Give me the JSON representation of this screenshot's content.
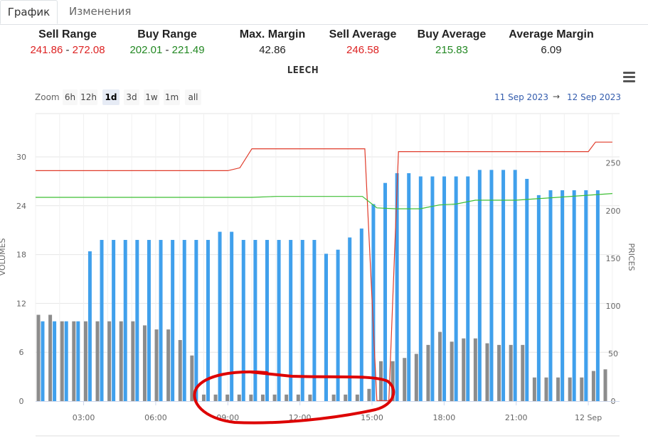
{
  "tabs": [
    "График",
    "Изменения"
  ],
  "stats": {
    "sell_range": {
      "label": "Sell Range",
      "low": "241.86",
      "sep": "-",
      "high": "272.08"
    },
    "buy_range": {
      "label": "Buy Range",
      "low": "202.01",
      "sep": "-",
      "high": "221.49"
    },
    "max_margin": {
      "label": "Max. Margin",
      "value": "42.86"
    },
    "sell_average": {
      "label": "Sell Average",
      "value": "246.58"
    },
    "buy_average": {
      "label": "Buy Average",
      "value": "215.83"
    },
    "average_margin": {
      "label": "Average Margin",
      "value": "6.09"
    }
  },
  "zoom": {
    "label": "Zoom",
    "buttons": [
      "6h",
      "12h",
      "1d",
      "3d",
      "1w",
      "1m",
      "all"
    ],
    "selected": "1d"
  },
  "date_range": {
    "from": "11 Sep 2023",
    "arrow": "→",
    "to": "12 Sep 2023"
  },
  "chart_data": {
    "type": "bar+line",
    "title": "LEECH",
    "x_ticks": [
      "03:00",
      "06:00",
      "09:00",
      "12:00",
      "15:00",
      "18:00",
      "21:00",
      "12 Sep"
    ],
    "x_start_hour": 1.0,
    "x_end_hour": 25.3,
    "y_left": {
      "label": "VOLUMES",
      "ticks": [
        "0",
        "6",
        "12",
        "18",
        "24",
        "30"
      ],
      "range": [
        0,
        30
      ]
    },
    "y_right": {
      "label": "PRICES",
      "ticks": [
        "0",
        "50",
        "100",
        "150",
        "200",
        "250"
      ],
      "range": [
        0,
        256.5
      ]
    },
    "colors": {
      "gray_bars": "#8c8c8c",
      "blue_bars": "#40a0ec",
      "sell_line": "#e03b2a",
      "buy_line": "#3dbf33",
      "annotation": "#dd0000"
    },
    "series": [
      {
        "type": "column",
        "axis": "left",
        "color_key": "gray_bars",
        "values": [
          10.6,
          10.6,
          9.8,
          9.8,
          9.8,
          9.8,
          9.8,
          9.8,
          9.8,
          9.3,
          8.8,
          8.8,
          7.5,
          5.6,
          0.8,
          0.8,
          0.8,
          0.8,
          0.8,
          0.8,
          0.8,
          0.8,
          0.8,
          0.8,
          0,
          0.8,
          0.8,
          0.8,
          1.5,
          4.9,
          4.9,
          5.3,
          5.8,
          6.9,
          8.5,
          7.3,
          7.7,
          7.7,
          7.1,
          6.9,
          6.9,
          6.9,
          2.9,
          2.9,
          2.9,
          2.9,
          2.9,
          3.7,
          3.9
        ]
      },
      {
        "type": "column",
        "axis": "left",
        "color_key": "blue_bars",
        "values": [
          9.8,
          9.8,
          9.8,
          9.8,
          18.4,
          19.8,
          19.8,
          19.8,
          19.8,
          19.8,
          19.8,
          19.8,
          19.8,
          19.8,
          19.8,
          20.8,
          20.8,
          19.8,
          19.8,
          19.8,
          19.8,
          19.8,
          19.8,
          19.8,
          18.1,
          18.6,
          20.1,
          21.2,
          24.2,
          26.8,
          28.0,
          28.0,
          27.6,
          27.6,
          27.6,
          27.6,
          27.6,
          28.4,
          28.4,
          28.4,
          28.4,
          27.3,
          25.3,
          25.9,
          25.9,
          25.9,
          25.9,
          25.9
        ]
      },
      {
        "type": "line",
        "axis": "right",
        "color_key": "sell_line",
        "points": [
          [
            1.0,
            242
          ],
          [
            9.0,
            242
          ],
          [
            9.5,
            245
          ],
          [
            10.0,
            265
          ],
          [
            12.0,
            265
          ],
          [
            14.7,
            265
          ],
          [
            15.2,
            0.5
          ],
          [
            15.7,
            0.5
          ],
          [
            16.1,
            262
          ],
          [
            22.0,
            262
          ],
          [
            24.0,
            262
          ],
          [
            24.3,
            272
          ],
          [
            25.0,
            272
          ]
        ]
      },
      {
        "type": "line",
        "axis": "right",
        "color_key": "buy_line",
        "points": [
          [
            1.0,
            214
          ],
          [
            10.0,
            214
          ],
          [
            11.0,
            215
          ],
          [
            14.0,
            215
          ],
          [
            14.6,
            215
          ],
          [
            15.2,
            203
          ],
          [
            16.0,
            202
          ],
          [
            17.0,
            202
          ],
          [
            17.8,
            206
          ],
          [
            18.5,
            207
          ],
          [
            19.3,
            211
          ],
          [
            21.0,
            211
          ],
          [
            25.0,
            218
          ]
        ]
      }
    ]
  }
}
